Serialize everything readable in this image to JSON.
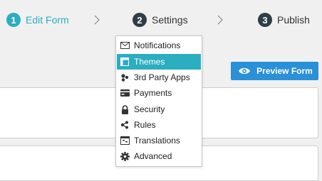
{
  "stepper": {
    "steps": [
      {
        "number": "1",
        "label": "Edit Form"
      },
      {
        "number": "2",
        "label": "Settings"
      },
      {
        "number": "3",
        "label": "Publish"
      }
    ]
  },
  "toolbar": {
    "preview_label": "Preview Form"
  },
  "settings_menu": {
    "selected": "Themes",
    "items": [
      {
        "label": "Notifications",
        "icon": "envelope-icon"
      },
      {
        "label": "Themes",
        "icon": "theme-icon"
      },
      {
        "label": "3rd Party Apps",
        "icon": "apps-icon"
      },
      {
        "label": "Payments",
        "icon": "credit-card-icon"
      },
      {
        "label": "Security",
        "icon": "lock-icon"
      },
      {
        "label": "Rules",
        "icon": "share-icon"
      },
      {
        "label": "Translations",
        "icon": "translate-icon"
      },
      {
        "label": "Advanced",
        "icon": "gear-icon"
      }
    ]
  },
  "colors": {
    "accent": "#2aaec0",
    "step_dark": "#2f3e46",
    "preview_button": "#2a90d8",
    "background": "#f0f0f0"
  }
}
